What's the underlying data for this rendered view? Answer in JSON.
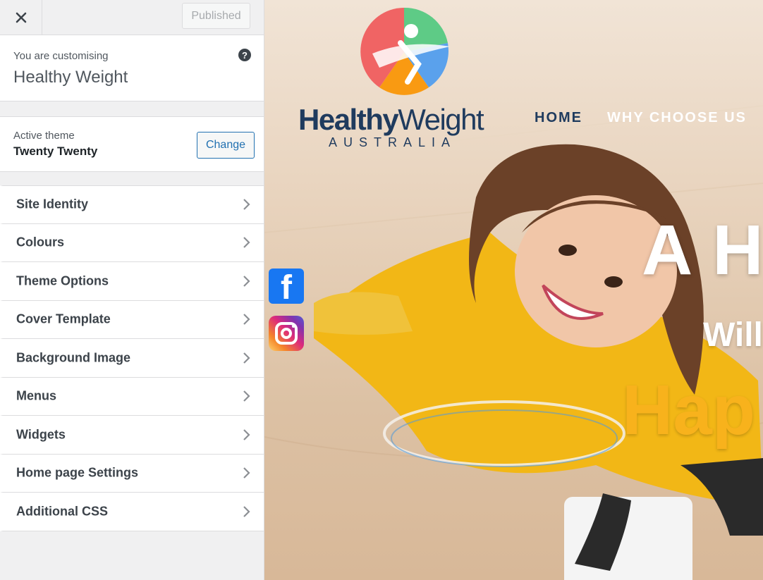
{
  "header": {
    "close_icon": "close-icon",
    "publish_label": "Published"
  },
  "info": {
    "small": "You are customising",
    "site_name": "Healthy Weight",
    "help_icon": "help-icon",
    "help_glyph": "?"
  },
  "theme": {
    "label": "Active theme",
    "name": "Twenty Twenty",
    "change_label": "Change"
  },
  "menu": {
    "items": [
      {
        "label": "Site Identity"
      },
      {
        "label": "Colours"
      },
      {
        "label": "Theme Options"
      },
      {
        "label": "Cover Template"
      },
      {
        "label": "Background Image"
      },
      {
        "label": "Menus"
      },
      {
        "label": "Widgets"
      },
      {
        "label": "Home page Settings"
      },
      {
        "label": "Additional CSS"
      }
    ],
    "chevron_icon": "chevron-right-icon"
  },
  "preview": {
    "logo_text_bold": "Healthy",
    "logo_text_light": "Weight",
    "logo_sub": "AUSTRALIA",
    "nav": {
      "home": "HOME",
      "why": "WHY CHOOSE US"
    },
    "hero_title": "A H",
    "hero_sub": "Will",
    "hero_happy": "Hap",
    "social": {
      "facebook_icon": "facebook-icon",
      "instagram_icon": "instagram-icon",
      "facebook_glyph": "f"
    },
    "colors": {
      "navy": "#1f3b5e",
      "accent_yellow": "#f8b21c",
      "wp_blue": "#2271b1"
    }
  }
}
